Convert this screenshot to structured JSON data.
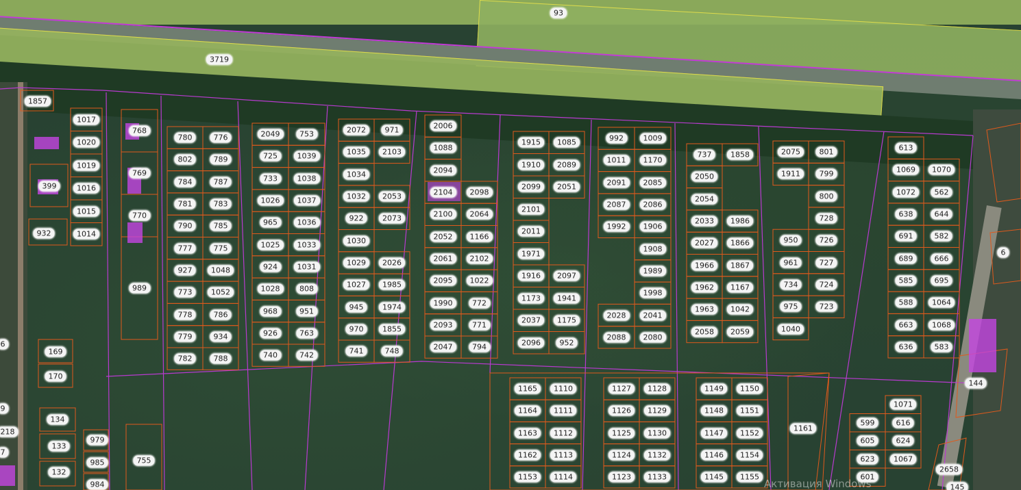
{
  "colors": {
    "parcel_border": "#e05a1c",
    "quarter_border": "#b93ad0",
    "field_border": "#e8e24a",
    "label_bg": "#f4f4f4",
    "building": "#c445e2"
  },
  "watermark": "Активация Windows",
  "blocks": [
    {
      "cols": 1,
      "labels": [
        "1017",
        "1020",
        "1019",
        "1016",
        "1015",
        "1014"
      ]
    },
    {
      "cols": 1,
      "labels": [
        "768",
        "769",
        "770",
        "989"
      ]
    },
    {
      "cols": 2,
      "labels": [
        "780",
        "776",
        "802",
        "789",
        "784",
        "787",
        "781",
        "783",
        "790",
        "785",
        "777",
        "775",
        "927",
        "1048",
        "773",
        "1052",
        "778",
        "786",
        "779",
        "934",
        "782",
        "788"
      ]
    },
    {
      "cols": 2,
      "labels": [
        "2049",
        "753",
        "725",
        "1039",
        "733",
        "1038",
        "1026",
        "1037",
        "965",
        "1036",
        "1025",
        "1033",
        "924",
        "1031",
        "1028",
        "808",
        "968",
        "951",
        "926",
        "763",
        "740",
        "742"
      ]
    },
    {
      "cols": 2,
      "labels": [
        "2072",
        "971",
        "1035",
        "2103",
        "1034",
        "",
        "1032",
        "2053",
        "922",
        "2073",
        "1030",
        "",
        "1029",
        "2026",
        "1027",
        "1985",
        "945",
        "1974",
        "970",
        "1855",
        "741",
        "748"
      ]
    },
    {
      "cols": 2,
      "labels": [
        "2006",
        "",
        "1088",
        "",
        "2094",
        "",
        "2104",
        "2098",
        "2100",
        "2064",
        "2052",
        "1166",
        "2061",
        "2102",
        "2095",
        "1022",
        "1990",
        "772",
        "2093",
        "771",
        "2047",
        "794"
      ]
    },
    {
      "cols": 2,
      "labels": [
        "1915",
        "1085",
        "1910",
        "2089",
        "2099",
        "2051",
        "2101",
        "",
        "2011",
        "",
        "1971",
        "",
        "1916",
        "2097",
        "1173",
        "1941",
        "2037",
        "1175",
        "2096",
        "952"
      ]
    },
    {
      "cols": 2,
      "labels": [
        "992",
        "1009",
        "1011",
        "1170",
        "2091",
        "2085",
        "2087",
        "2086",
        "1992",
        "1906",
        "",
        "1908",
        "",
        "1989",
        "",
        "1998",
        "2028",
        "2041",
        "2088",
        "2080"
      ]
    },
    {
      "cols": 2,
      "labels": [
        "737",
        "1858",
        "2050",
        "",
        "2054",
        "",
        "2033",
        "1986",
        "2027",
        "1866",
        "1966",
        "1867",
        "1962",
        "1167",
        "1963",
        "1042",
        "2058",
        "2059"
      ]
    },
    {
      "cols": 2,
      "labels": [
        "2075",
        "801",
        "1911",
        "799",
        "",
        "800",
        "",
        "728",
        "950",
        "726",
        "961",
        "727",
        "734",
        "724",
        "975",
        "723",
        "1040",
        ""
      ]
    },
    {
      "cols": 2,
      "labels": [
        "613",
        "",
        "1069",
        "1070",
        "1072",
        "562",
        "638",
        "644",
        "691",
        "582",
        "689",
        "666",
        "585",
        "695",
        "588",
        "1064",
        "663",
        "1068",
        "636",
        "583"
      ]
    },
    {
      "cols": 2,
      "labels": [
        "1165",
        "1110",
        "1164",
        "1111",
        "1163",
        "1112",
        "1162",
        "1113",
        "1153",
        "1114"
      ]
    },
    {
      "cols": 2,
      "labels": [
        "1127",
        "1128",
        "1126",
        "1129",
        "1125",
        "1130",
        "1124",
        "1132",
        "1123",
        "1133"
      ]
    },
    {
      "cols": 2,
      "labels": [
        "1149",
        "1150",
        "1148",
        "1151",
        "1147",
        "1152",
        "1146",
        "1154",
        "1145",
        "1155"
      ]
    },
    {
      "cols": 2,
      "labels": [
        "",
        "1071",
        "599",
        "616",
        "605",
        "624",
        "623",
        "1067",
        "601",
        ""
      ]
    }
  ],
  "labels": [
    "93",
    "3719",
    "1857",
    "399",
    "932",
    "169",
    "170",
    "134",
    "133",
    "132",
    "979",
    "985",
    "984",
    "755",
    "1161",
    "2658",
    "144",
    "6",
    "218",
    "7",
    "9",
    "6",
    "145"
  ]
}
